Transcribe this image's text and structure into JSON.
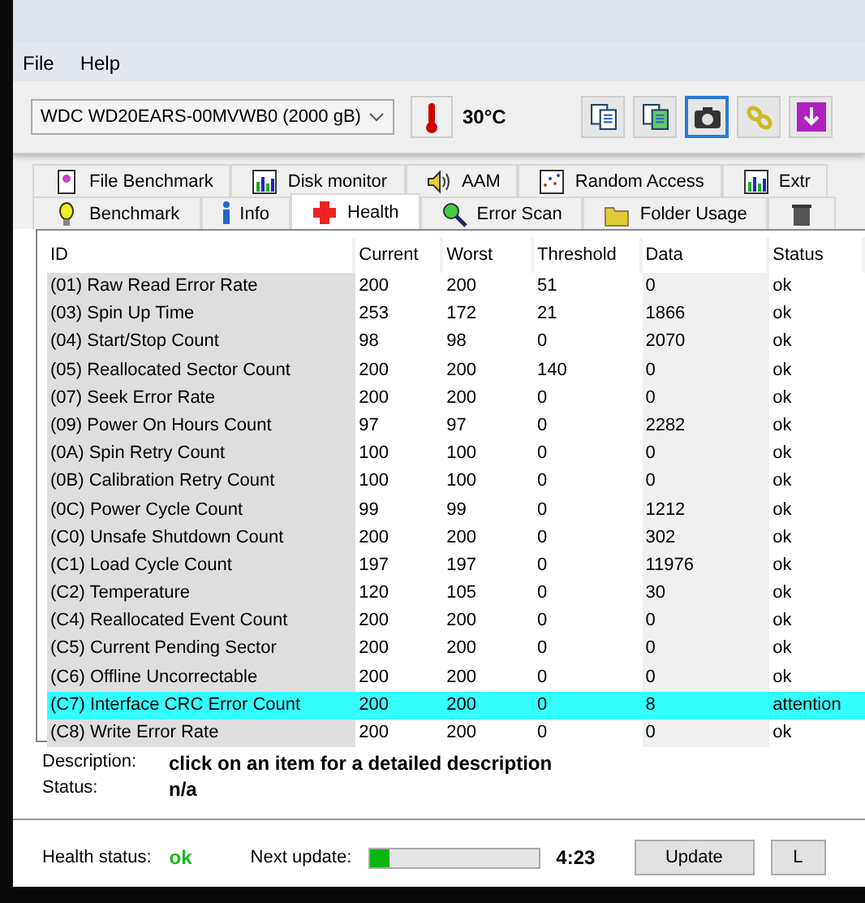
{
  "menu": [
    "File",
    "Help"
  ],
  "toolbar": {
    "drive": "WDC WD20EARS-00MVWB0 (2000 gB)",
    "temperature": "30°C",
    "buttons": [
      {
        "kind": "copy",
        "selected": false
      },
      {
        "kind": "copy-color",
        "selected": false
      },
      {
        "kind": "camera",
        "selected": true
      },
      {
        "kind": "chain",
        "selected": false
      },
      {
        "kind": "download",
        "selected": false
      }
    ]
  },
  "tabs_top": [
    {
      "label": "File Benchmark",
      "kind": "file",
      "selected": false
    },
    {
      "label": "Disk monitor",
      "kind": "bars",
      "selected": false
    },
    {
      "label": "AAM",
      "kind": "speaker",
      "selected": false
    },
    {
      "label": "Random Access",
      "kind": "scatter",
      "selected": false
    },
    {
      "label": "Extr",
      "kind": "bars",
      "selected": false
    }
  ],
  "tabs_bottom": [
    {
      "label": "Benchmark",
      "kind": "bulb",
      "selected": false
    },
    {
      "label": "Info",
      "kind": "info",
      "selected": false
    },
    {
      "label": "Health",
      "kind": "cross",
      "selected": true
    },
    {
      "label": "Error Scan",
      "kind": "magnifier",
      "selected": false
    },
    {
      "label": "Folder Usage",
      "kind": "folder",
      "selected": false
    },
    {
      "kind": "trash",
      "selected": false
    }
  ],
  "table": {
    "columns": [
      "ID",
      "Current",
      "Worst",
      "Threshold",
      "Data",
      "Status"
    ],
    "rows": [
      {
        "cells": [
          "(01) Raw Read Error Rate",
          "200",
          "200",
          "51",
          "0",
          "ok"
        ],
        "selected": false
      },
      {
        "cells": [
          "(03) Spin Up Time",
          "253",
          "172",
          "21",
          "1866",
          "ok"
        ],
        "selected": false
      },
      {
        "cells": [
          "(04) Start/Stop Count",
          "98",
          "98",
          "0",
          "2070",
          "ok"
        ],
        "selected": false
      },
      {
        "cells": [
          "(05) Reallocated Sector Count",
          "200",
          "200",
          "140",
          "0",
          "ok"
        ],
        "selected": false
      },
      {
        "cells": [
          "(07) Seek Error Rate",
          "200",
          "200",
          "0",
          "0",
          "ok"
        ],
        "selected": false
      },
      {
        "cells": [
          "(09) Power On Hours Count",
          "97",
          "97",
          "0",
          "2282",
          "ok"
        ],
        "selected": false
      },
      {
        "cells": [
          "(0A) Spin Retry Count",
          "100",
          "100",
          "0",
          "0",
          "ok"
        ],
        "selected": false
      },
      {
        "cells": [
          "(0B) Calibration Retry Count",
          "100",
          "100",
          "0",
          "0",
          "ok"
        ],
        "selected": false
      },
      {
        "cells": [
          "(0C) Power Cycle Count",
          "99",
          "99",
          "0",
          "1212",
          "ok"
        ],
        "selected": false
      },
      {
        "cells": [
          "(C0) Unsafe Shutdown Count",
          "200",
          "200",
          "0",
          "302",
          "ok"
        ],
        "selected": false
      },
      {
        "cells": [
          "(C1) Load Cycle Count",
          "197",
          "197",
          "0",
          "11976",
          "ok"
        ],
        "selected": false
      },
      {
        "cells": [
          "(C2) Temperature",
          "120",
          "105",
          "0",
          "30",
          "ok"
        ],
        "selected": false
      },
      {
        "cells": [
          "(C4) Reallocated Event Count",
          "200",
          "200",
          "0",
          "0",
          "ok"
        ],
        "selected": false
      },
      {
        "cells": [
          "(C5) Current Pending Sector",
          "200",
          "200",
          "0",
          "0",
          "ok"
        ],
        "selected": false
      },
      {
        "cells": [
          "(C6) Offline Uncorrectable",
          "200",
          "200",
          "0",
          "0",
          "ok"
        ],
        "selected": false
      },
      {
        "cells": [
          "(C7) Interface CRC Error Count",
          "200",
          "200",
          "0",
          "8",
          "attention"
        ],
        "selected": true
      },
      {
        "cells": [
          "(C8) Write Error Rate",
          "200",
          "200",
          "0",
          "0",
          "ok"
        ],
        "selected": false
      }
    ]
  },
  "description": {
    "label": "Description:",
    "value": "click on an item for a detailed description"
  },
  "status": {
    "label": "Status:",
    "value": "n/a"
  },
  "footer": {
    "health_label": "Health status:",
    "health_value": "ok",
    "next_label": "Next update:",
    "level": 0.12,
    "time": "4:23",
    "buttons": [
      "Update",
      "L"
    ]
  }
}
